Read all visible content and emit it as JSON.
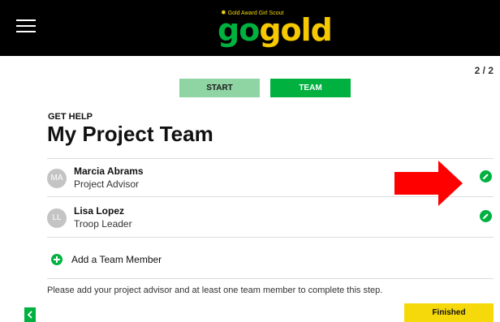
{
  "header": {
    "menu_icon": "hamburger-menu-icon",
    "logo": {
      "tagline": "Gold Award Girl Scout",
      "word_go": "go",
      "word_gold": "gold"
    },
    "colors": {
      "background": "#000000",
      "go": "#00b140",
      "gold": "#f5c800"
    }
  },
  "progress": {
    "page_indicator": "2 / 2"
  },
  "tabs": [
    {
      "label": "START",
      "active": false
    },
    {
      "label": "TEAM",
      "active": true
    }
  ],
  "section": {
    "label": "GET HELP",
    "title": "My Project Team"
  },
  "members": [
    {
      "initials": "MA",
      "name": "Marcia Abrams",
      "role": "Project Advisor",
      "edit_icon": "pencil-icon"
    },
    {
      "initials": "LL",
      "name": "Lisa Lopez",
      "role": "Troop Leader",
      "edit_icon": "pencil-icon"
    }
  ],
  "add_member": {
    "label": "Add a Team Member",
    "icon": "plus-circle-icon"
  },
  "help_text": "Please add your project advisor and at least one team member to complete this step.",
  "footer": {
    "back_icon": "chevron-left-icon",
    "finished_label": "Finished"
  },
  "annotation": {
    "icon": "red-arrow-icon",
    "color": "#ff0000"
  },
  "accent_colors": {
    "green": "#00b140",
    "light_green": "#8fd4a3",
    "yellow": "#f5d90a"
  }
}
